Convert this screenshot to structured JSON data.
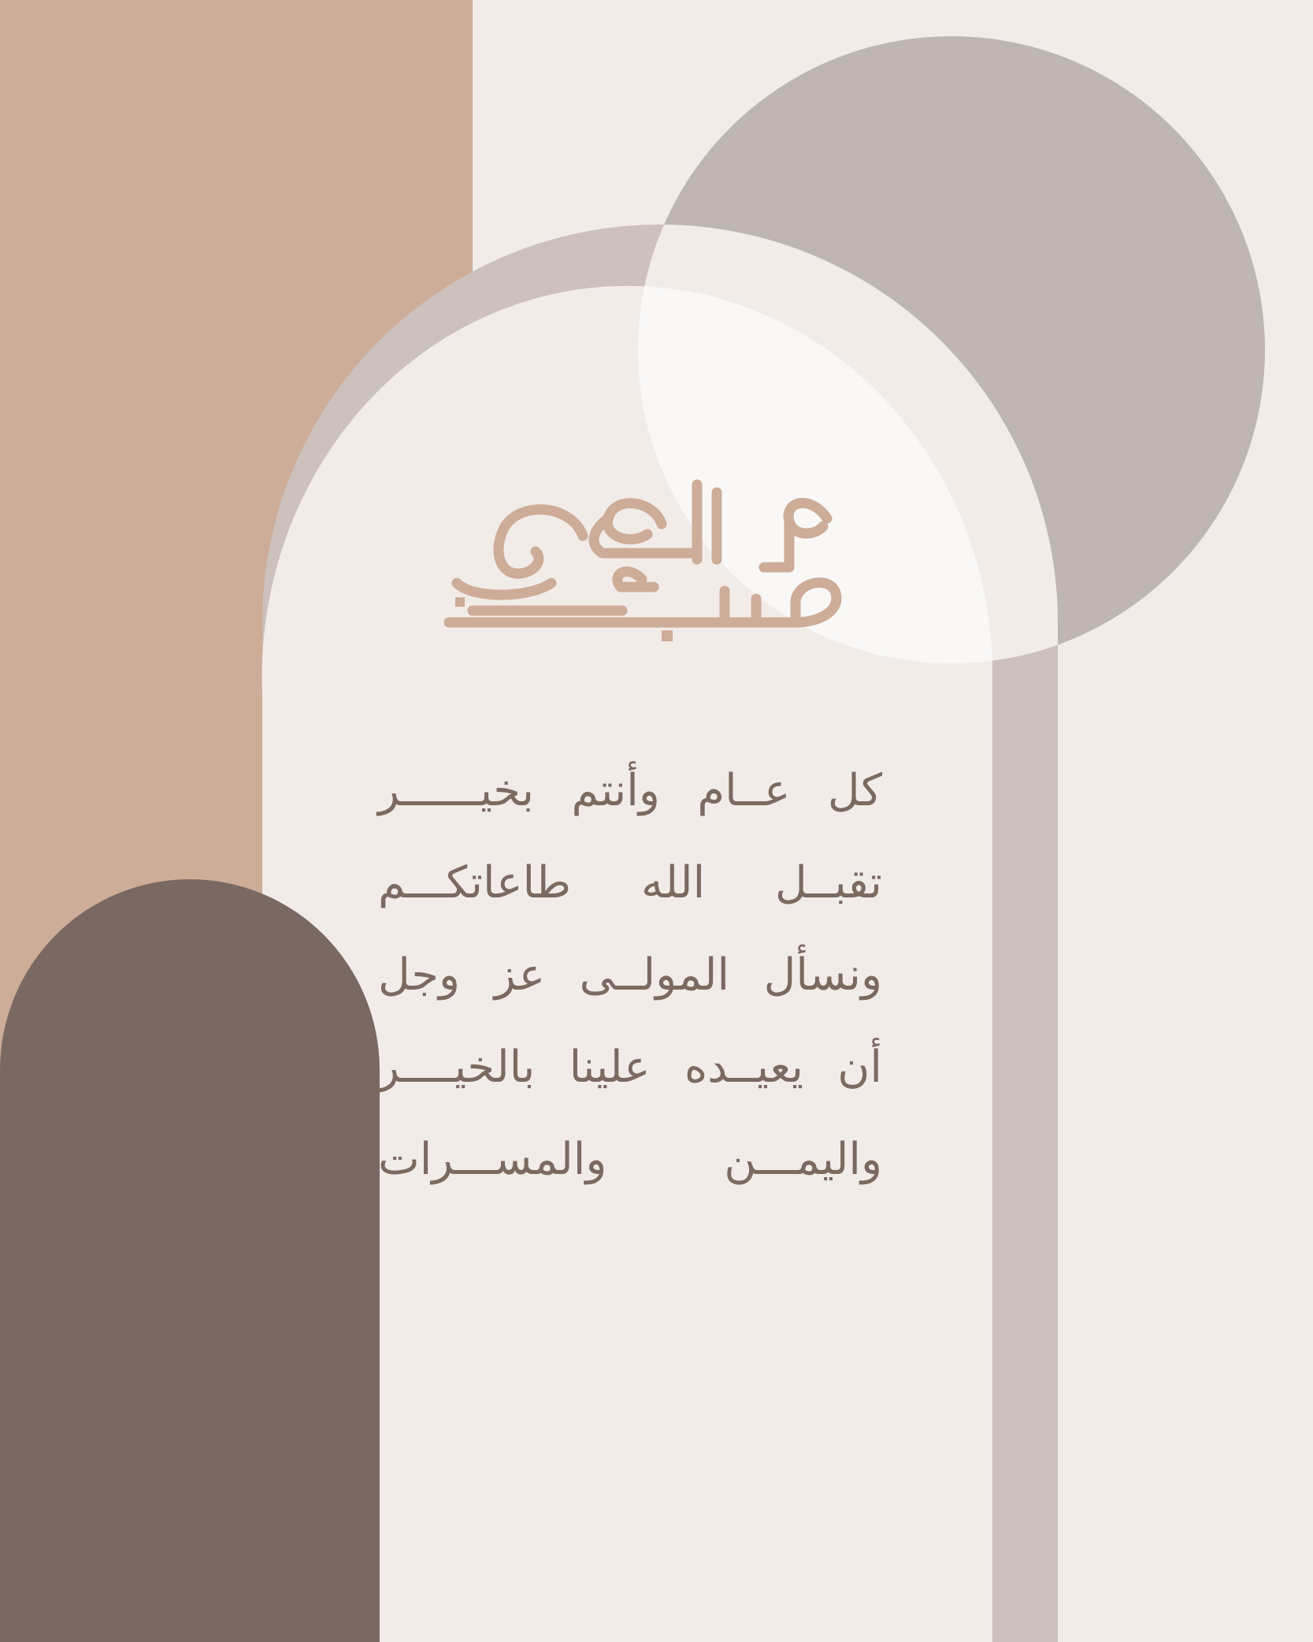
{
  "colors": {
    "background": "#f2ece9",
    "left_panel": "#cdac98",
    "big_circle": "#bfb5b1",
    "outer_arch": "#ccc1bc",
    "inner_arch": "#f2ece9",
    "overlap_highlight": "#f9f8f7",
    "dark_arch": "#7a6962",
    "text": "#7b6a61",
    "calligraphy": "#cdac98"
  },
  "logo": {
    "text": "عيدكم مبارك",
    "style": "kufic-calligraphy"
  },
  "greeting": {
    "lines": [
      "كل عــام وأنتم بخيــــــر",
      "تقبــل الله طاعاتكـــم",
      "ونسأل المولــى عز وجل",
      "أن يعيــده علينا بالخيــــر",
      "واليمـــن والمســـرات"
    ]
  }
}
